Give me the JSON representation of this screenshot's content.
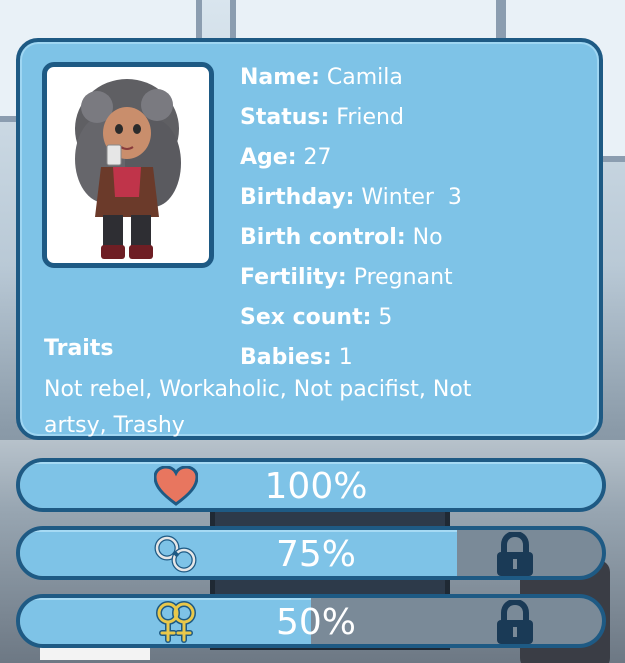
{
  "character": {
    "name_label": "Name:",
    "name": "Camila",
    "status_label": "Status:",
    "status": "Friend",
    "age_label": "Age:",
    "age": "27",
    "birthday_label": "Birthday:",
    "birthday": "Winter  3",
    "birth_control_label": "Birth control:",
    "birth_control": "No",
    "fertility_label": "Fertility:",
    "fertility": "Pregnant",
    "sex_count_label": "Sex count:",
    "sex_count": "5",
    "babies_label": "Babies:",
    "babies": "1",
    "traits_title": "Traits",
    "traits": "Not rebel, Workaholic, Not pacifist, Not artsy, Trashy"
  },
  "stats": [
    {
      "icon": "heart-icon",
      "label": "100%",
      "value": 1.0,
      "locked": false
    },
    {
      "icon": "handcuffs-icon",
      "label": "75%",
      "value": 0.75,
      "locked": true
    },
    {
      "icon": "female-female-icon",
      "label": "50%",
      "value": 0.5,
      "locked": true
    }
  ],
  "colors": {
    "panel": "#7ec3e7",
    "border": "#1e5a84",
    "heart": "#e8765f",
    "icon_gold": "#e9c84a"
  }
}
